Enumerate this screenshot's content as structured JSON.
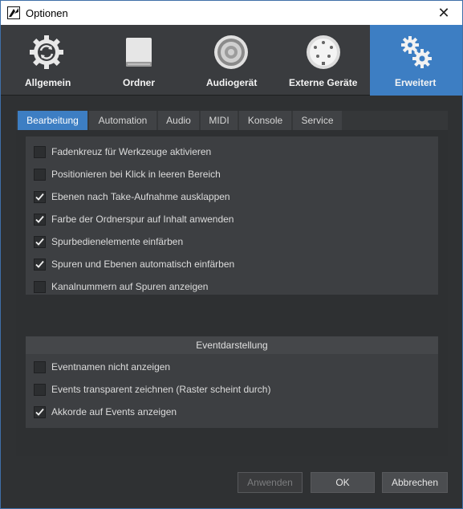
{
  "window": {
    "title": "Optionen",
    "close_glyph": "✕"
  },
  "categories": [
    {
      "label": "Allgemein",
      "icon": "sync-gear-icon"
    },
    {
      "label": "Ordner",
      "icon": "drive-icon"
    },
    {
      "label": "Audiogerät",
      "icon": "speaker-icon"
    },
    {
      "label": "Externe Geräte",
      "icon": "midi-connector-icon"
    },
    {
      "label": "Erweitert",
      "icon": "gears-icon",
      "active": true
    }
  ],
  "tabs": [
    {
      "label": "Bearbeitung",
      "active": true
    },
    {
      "label": "Automation"
    },
    {
      "label": "Audio"
    },
    {
      "label": "MIDI"
    },
    {
      "label": "Konsole"
    },
    {
      "label": "Service"
    }
  ],
  "editing_options": [
    {
      "label": "Fadenkreuz für Werkzeuge aktivieren",
      "checked": false
    },
    {
      "label": "Positionieren bei Klick in leeren Bereich",
      "checked": false
    },
    {
      "label": "Ebenen nach Take-Aufnahme ausklappen",
      "checked": true
    },
    {
      "label": "Farbe der Ordnerspur auf Inhalt anwenden",
      "checked": true
    },
    {
      "label": "Spurbedienelemente einfärben",
      "checked": true
    },
    {
      "label": "Spuren und Ebenen automatisch einfärben",
      "checked": true
    },
    {
      "label": "Kanalnummern auf Spuren anzeigen",
      "checked": false
    }
  ],
  "event_section": {
    "title": "Eventdarstellung",
    "options": [
      {
        "label": "Eventnamen nicht anzeigen",
        "checked": false
      },
      {
        "label": "Events transparent zeichnen (Raster scheint durch)",
        "checked": false
      },
      {
        "label": "Akkorde auf Events anzeigen",
        "checked": true
      }
    ]
  },
  "buttons": {
    "apply": "Anwenden",
    "ok": "OK",
    "cancel": "Abbrechen"
  },
  "colors": {
    "accent": "#3d7ec3",
    "background": "#2f3133",
    "text": "#dcdcdc"
  }
}
